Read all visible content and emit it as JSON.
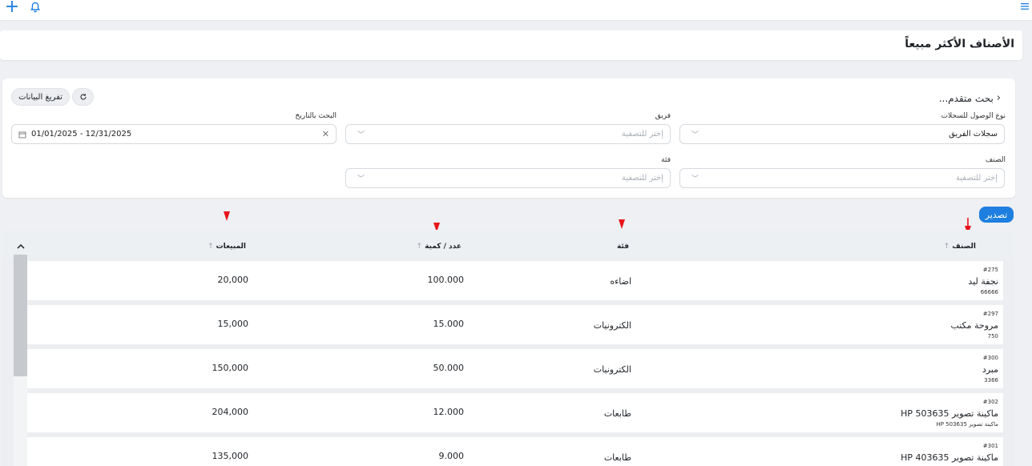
{
  "page": {
    "title": "الأصناف الأكثر مبيعاً"
  },
  "toolbar": {
    "add_icon": "plus-icon",
    "notifications_icon": "bell-icon",
    "menu_icon": "hamburger-icon"
  },
  "filters": {
    "advanced_search": "بحث متقدم...",
    "clear_button": "تفريغ البيانات",
    "refresh_icon": "refresh-icon",
    "record_access_label": "نوع الوصول للسجلات",
    "record_access_value": "سجلات الفريق",
    "team_label": "فريق",
    "team_placeholder": "إختر للتصفية",
    "date_label": "البحث بالتاريخ",
    "date_value": "01/01/2025 - 12/31/2025",
    "item_label": "الصنف",
    "item_placeholder": "إختر للتصفية",
    "category_label": "فئة",
    "category_placeholder": "إختر للتصفية"
  },
  "export_label": "تصدير",
  "table": {
    "columns": {
      "item": "الصنف",
      "category": "فئة",
      "qty": "عدد / كمية",
      "sales": "المبيعات"
    },
    "rows": [
      {
        "code": "#275",
        "name": "نجفة ليد",
        "sub": "66666",
        "category": "اضاءه",
        "qty": "100.000",
        "sales": "20,000"
      },
      {
        "code": "#297",
        "name": "مروحة مكتب",
        "sub": "750",
        "category": "الكترونيات",
        "qty": "15.000",
        "sales": "15,000"
      },
      {
        "code": "#300",
        "name": "مبرد",
        "sub": "3366",
        "category": "الكترونيات",
        "qty": "50.000",
        "sales": "150,000"
      },
      {
        "code": "#302",
        "name": "ماكينة تصوير HP 503635",
        "sub": "ماكينة تصوير HP 503635",
        "category": "طابعات",
        "qty": "12.000",
        "sales": "204,000"
      },
      {
        "code": "#301",
        "name": "ماكينة تصوير HP 403635",
        "sub": "",
        "category": "طابعات",
        "qty": "9.000",
        "sales": "135,000"
      }
    ]
  },
  "colors": {
    "accent": "#1e7fe0",
    "arrow": "#e8141b"
  }
}
